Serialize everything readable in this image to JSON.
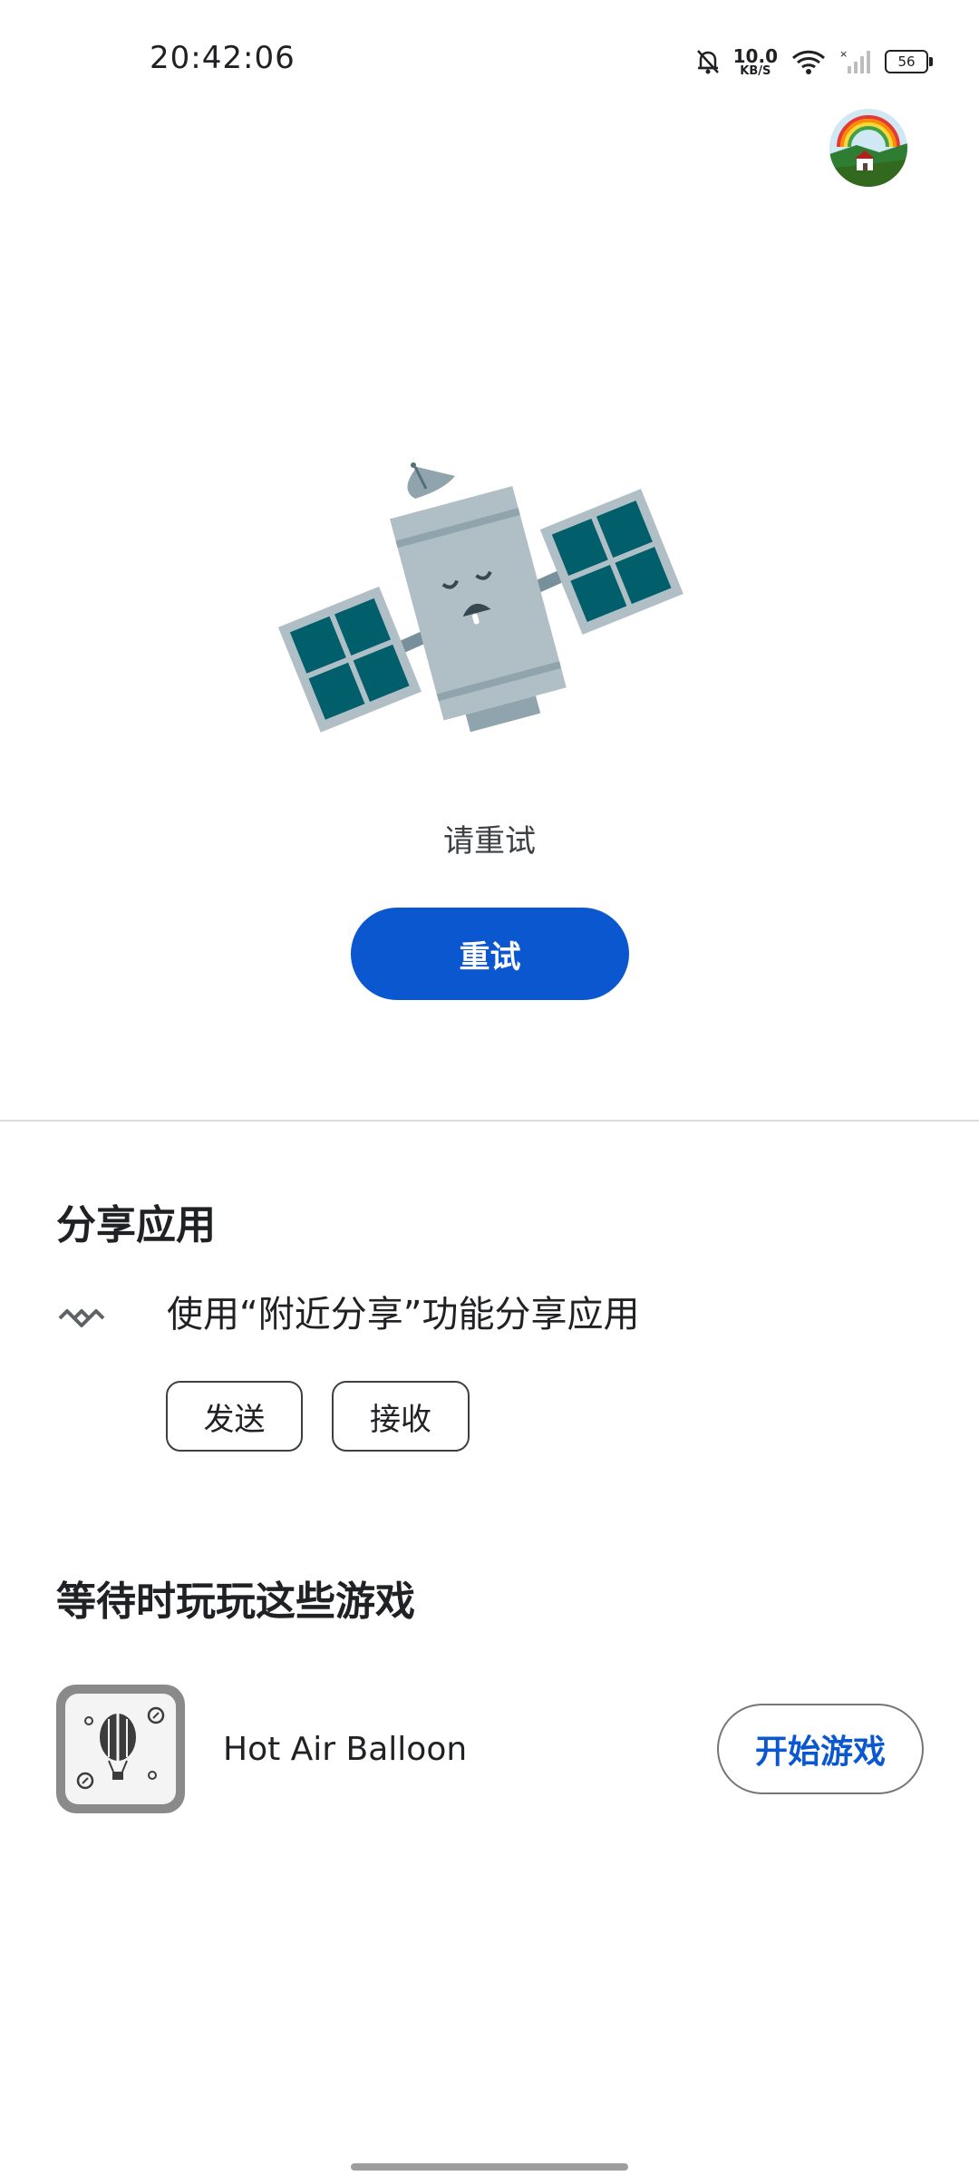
{
  "status_bar": {
    "time": "20:42:06",
    "net_speed_value": "10.0",
    "net_speed_unit": "KB/S",
    "battery": "56"
  },
  "error": {
    "message": "请重试",
    "retry_label": "重试"
  },
  "share": {
    "title": "分享应用",
    "description": "使用“附近分享”功能分享应用",
    "send_label": "发送",
    "receive_label": "接收"
  },
  "games": {
    "title": "等待时玩玩这些游戏",
    "items": [
      {
        "name": "Hot Air Balloon",
        "play_label": "开始游戏"
      }
    ]
  },
  "colors": {
    "accent": "#0b57d0",
    "satellite_panel": "#005f6b",
    "satellite_body": "#b0bec5"
  }
}
